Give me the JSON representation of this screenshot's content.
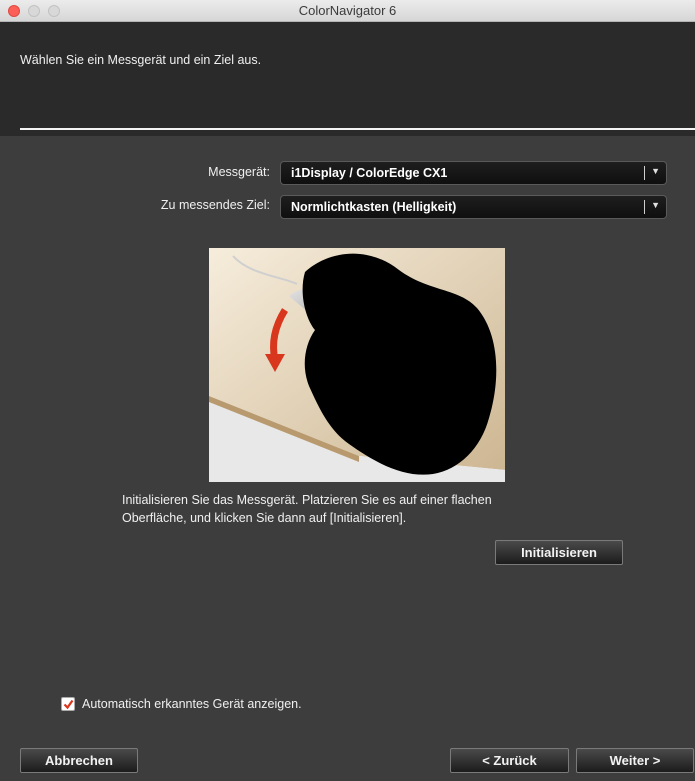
{
  "window": {
    "title": "ColorNavigator 6"
  },
  "header": {
    "instruction": "Wählen Sie ein Messgerät und ein Ziel aus."
  },
  "form": {
    "device_label": "Messgerät:",
    "device_value": "i1Display / ColorEdge CX1",
    "target_label": "Zu messendes Ziel:",
    "target_value": "Normlichtkasten (Helligkeit)"
  },
  "illustration": {
    "icon": "hand-holding-sensor-illustration"
  },
  "description": {
    "line1": "Initialisieren Sie das Messgerät. Platzieren Sie es auf einer flachen",
    "line2": "Oberfläche, und klicken Sie dann auf [Initialisieren]."
  },
  "buttons": {
    "initialize": "Initialisieren",
    "cancel": "Abbrechen",
    "back": "< Zurück",
    "next": "Weiter >"
  },
  "option": {
    "checked": true,
    "label": "Automatisch erkanntes Gerät anzeigen."
  },
  "colors": {
    "checkmark": "#d9361e",
    "arrow": "#d9361e",
    "background": "#3d3d3d"
  }
}
